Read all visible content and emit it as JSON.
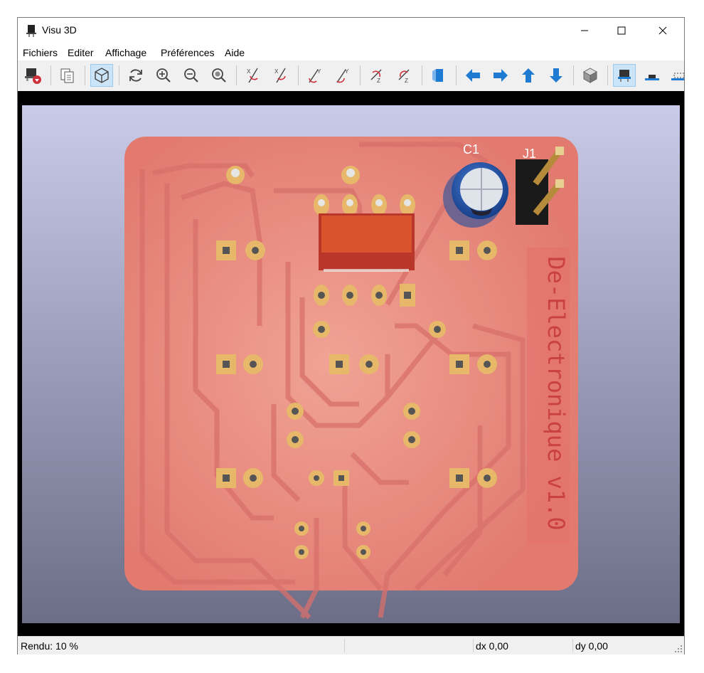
{
  "window": {
    "title": "Visu 3D"
  },
  "menu": [
    "Fichiers",
    "Editer",
    "Affichage",
    "Préférences",
    "Aide"
  ],
  "toolbar": {
    "tools": [
      "reload-board-icon",
      "copy-image-icon",
      "render-mode-icon",
      "refresh-icon",
      "zoom-in-icon",
      "zoom-out-icon",
      "zoom-fit-icon",
      "rotate-x-cw-icon",
      "rotate-x-ccw-icon",
      "rotate-y-cw-icon",
      "rotate-y-ccw-icon",
      "rotate-z-cw-icon",
      "rotate-z-ccw-icon",
      "flip-board-icon",
      "move-left-icon",
      "move-right-icon",
      "move-up-icon",
      "move-down-icon",
      "3d-view-icon",
      "show-tht-icon",
      "show-smd-icon",
      "show-virtual-icon"
    ],
    "accent": "#1f7ad1"
  },
  "board": {
    "silkscreen_text": "De-Electronique v1.0",
    "refs": [
      "C1",
      "J1"
    ],
    "colors": {
      "background_top": "#c8c9e6",
      "background_bottom": "#6d6e88",
      "pcb": "#e88a7c",
      "pads": "#e7b86a",
      "capacitor": "#2e63b8",
      "component_red": "#d9532c"
    }
  },
  "status": {
    "render": "Rendu: 10 %",
    "dx": "dx 0,00",
    "dy": "dy 0,00"
  }
}
